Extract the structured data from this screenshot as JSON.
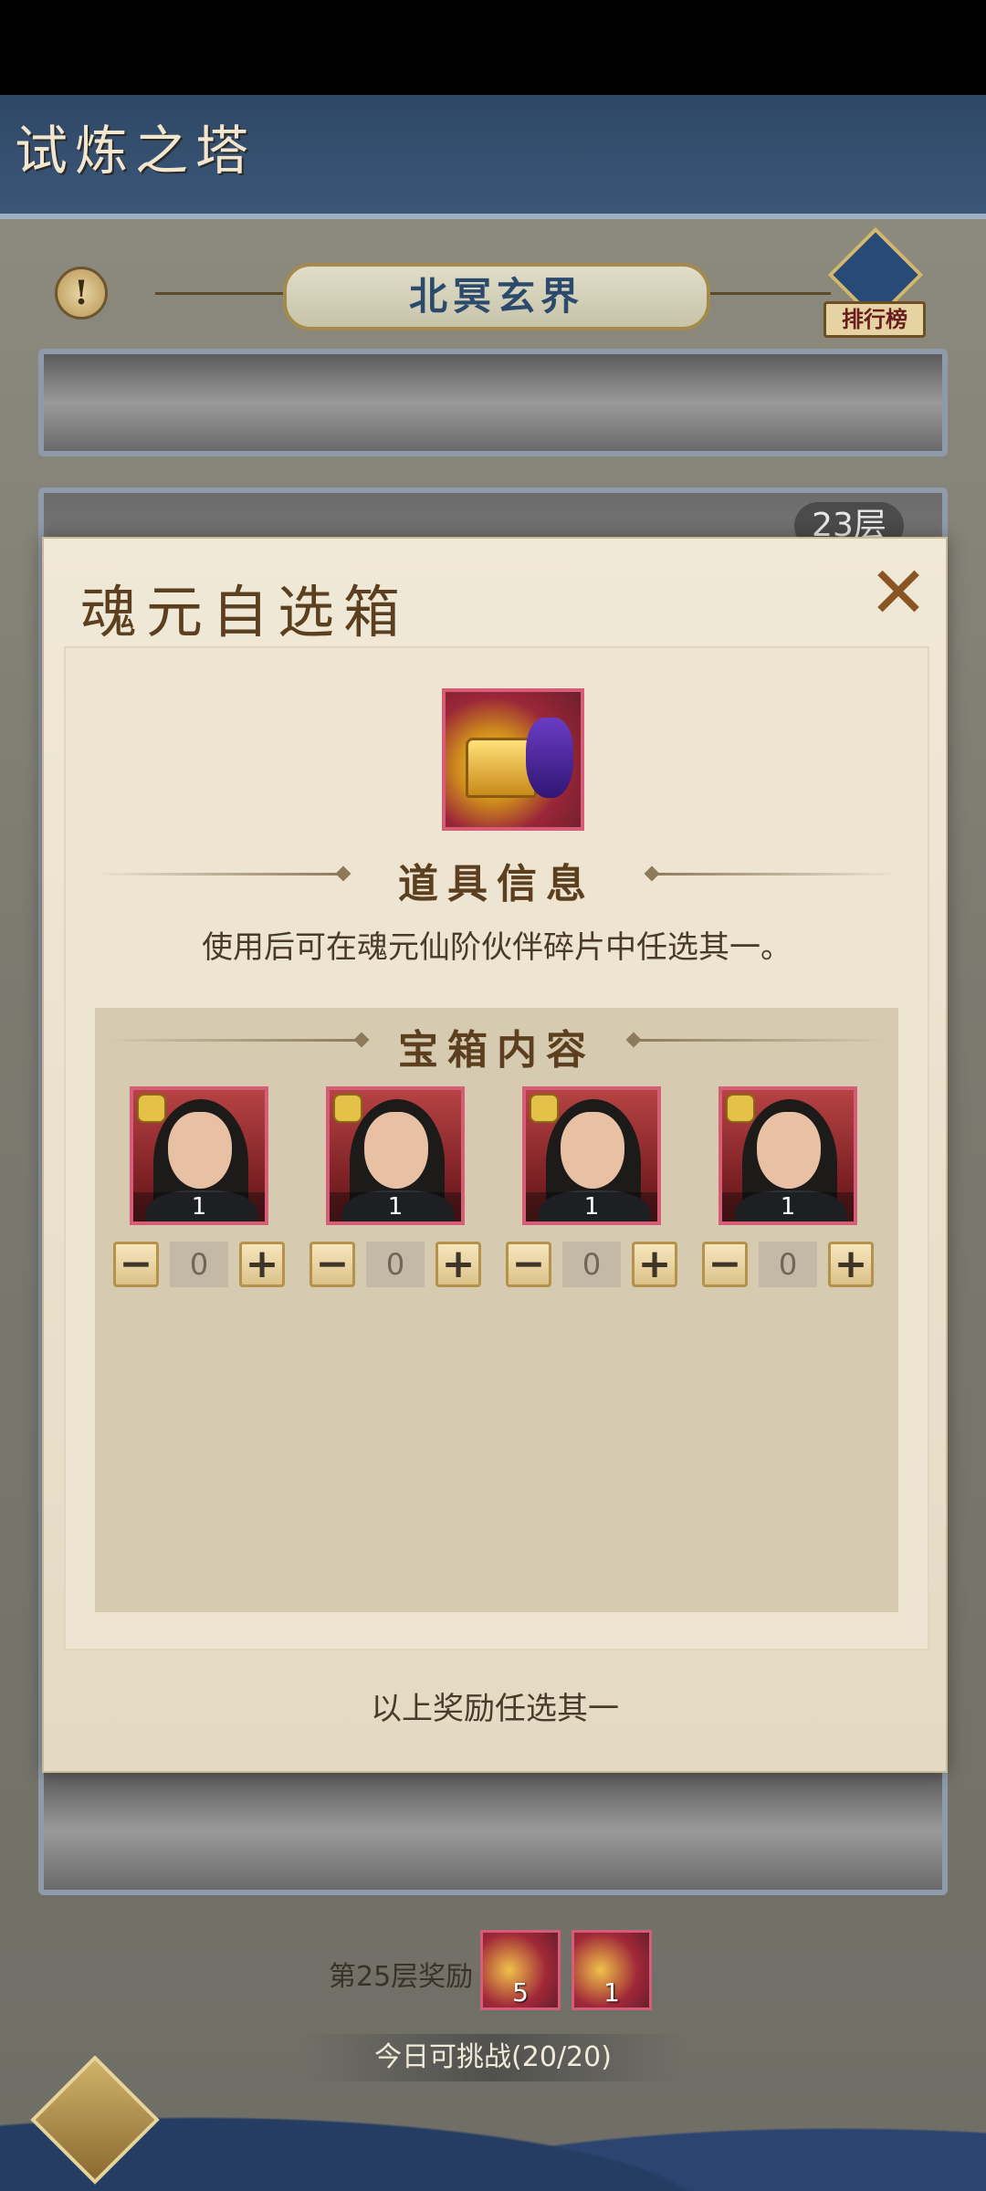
{
  "header": {
    "title": "试炼之塔"
  },
  "realm": {
    "name": "北冥玄界",
    "info_icon": "exclamation-icon",
    "rank_label": "排行榜"
  },
  "floors": {
    "label_23": "23层"
  },
  "modal": {
    "title": "魂元自选箱",
    "close_icon": "close-x-icon",
    "item_info_heading": "道具信息",
    "item_description": "使用后可在魂元仙阶伙伴碎片中任选其一。",
    "content_heading": "宝箱内容",
    "footer_note": "以上奖励任选其一",
    "heroes": [
      {
        "count": "1",
        "selected": "0"
      },
      {
        "count": "1",
        "selected": "0"
      },
      {
        "count": "1",
        "selected": "0"
      },
      {
        "count": "1",
        "selected": "0"
      }
    ],
    "minus_symbol": "−",
    "plus_symbol": "+"
  },
  "reward": {
    "label": "第25层奖励",
    "items": [
      {
        "qty": "5"
      },
      {
        "qty": "1"
      }
    ]
  },
  "challenge": {
    "text": "今日可挑战(20/20)"
  },
  "colors": {
    "accent": "#d55d78",
    "parchment": "#ede4d2",
    "header_blue": "#2f4766"
  }
}
